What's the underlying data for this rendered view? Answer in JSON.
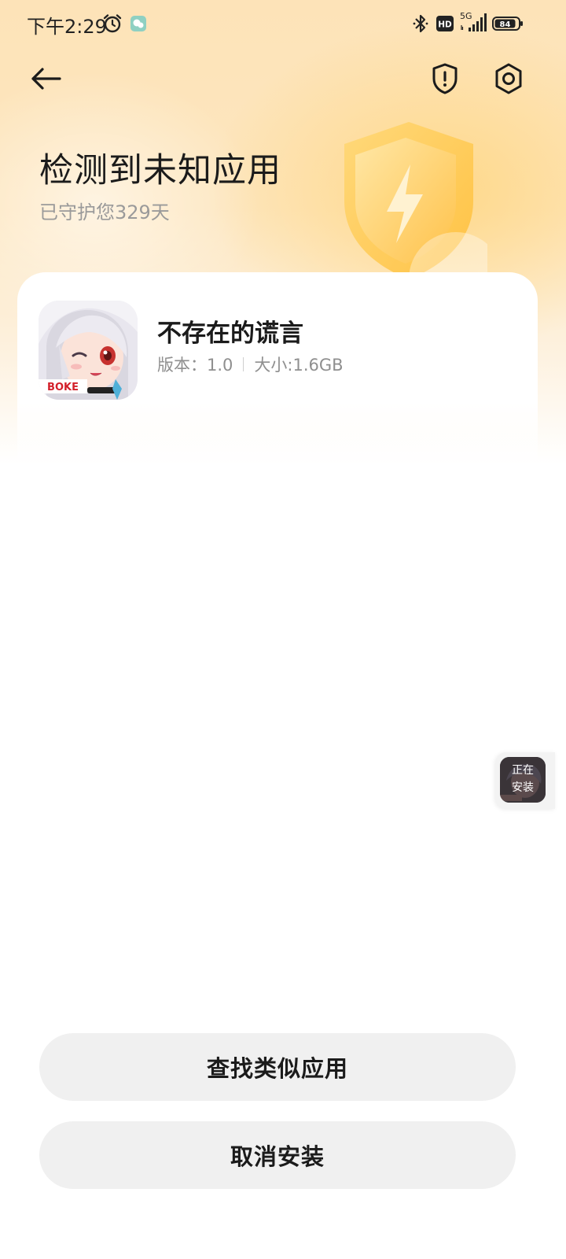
{
  "status_bar": {
    "time": "下午2:29",
    "network": "5G",
    "hd_badge": "HD",
    "battery": "84"
  },
  "toolbar": {
    "back_icon": "back-arrow-icon",
    "shield_icon": "shield-alert-icon",
    "settings_icon": "settings-gear-icon"
  },
  "hero": {
    "title": "检测到未知应用",
    "subtitle": "已守护您329天",
    "shield_icon": "lightning-shield-icon"
  },
  "app": {
    "name": "不存在的谎言",
    "version_label": "版本：1.0",
    "size_label": "大小:1.6GB",
    "icon_brand": "BOKE"
  },
  "install_bubble": {
    "line1": "正在",
    "line2": "安装"
  },
  "buttons": {
    "find_similar": "查找类似应用",
    "cancel_install": "取消安装"
  },
  "colors": {
    "hero_bg": "#fde3b8",
    "button_bg": "#f0f0f0",
    "title_text": "#1b1b1b",
    "muted_text": "#9a9a9a"
  }
}
